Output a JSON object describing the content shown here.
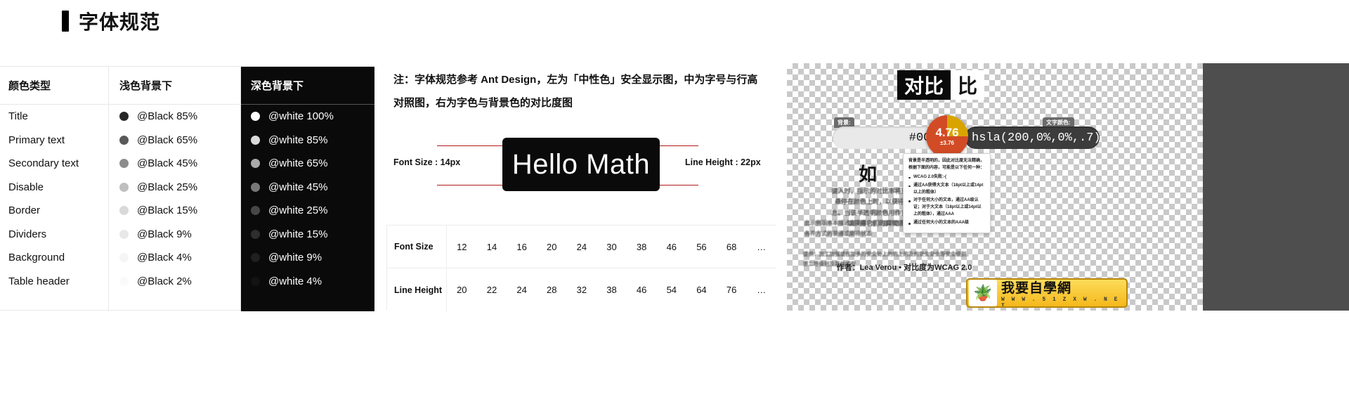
{
  "page": {
    "title": "字体规范"
  },
  "color_table": {
    "headers": [
      "颜色类型",
      "浅色背景下",
      "深色背景下"
    ],
    "rows": [
      {
        "type": "Title",
        "light": "@Black 85%",
        "light_swatch": "rgba(0,0,0,0.85)",
        "dark": "@white 100%",
        "dark_swatch": "rgba(255,255,255,1)"
      },
      {
        "type": "Primary text",
        "light": "@Black 65%",
        "light_swatch": "rgba(0,0,0,0.65)",
        "dark": "@white 85%",
        "dark_swatch": "rgba(255,255,255,0.85)"
      },
      {
        "type": "Secondary text",
        "light": "@Black 45%",
        "light_swatch": "rgba(0,0,0,0.45)",
        "dark": "@white 65%",
        "dark_swatch": "rgba(255,255,255,0.65)"
      },
      {
        "type": "Disable",
        "light": "@Black 25%",
        "light_swatch": "rgba(0,0,0,0.25)",
        "dark": "@white 45%",
        "dark_swatch": "rgba(255,255,255,0.45)"
      },
      {
        "type": "Border",
        "light": "@Black 15%",
        "light_swatch": "rgba(0,0,0,0.15)",
        "dark": "@white 25%",
        "dark_swatch": "rgba(255,255,255,0.25)"
      },
      {
        "type": "Dividers",
        "light": "@Black 9%",
        "light_swatch": "rgba(0,0,0,0.09)",
        "dark": "@white 15%",
        "dark_swatch": "rgba(255,255,255,0.15)"
      },
      {
        "type": "Background",
        "light": "@Black 4%",
        "light_swatch": "rgba(0,0,0,0.04)",
        "dark": "@white 9%",
        "dark_swatch": "rgba(255,255,255,0.09)"
      },
      {
        "type": "Table header",
        "light": "@Black 2%",
        "light_swatch": "rgba(0,0,0,0.02)",
        "dark": "@white 4%",
        "dark_swatch": "rgba(255,255,255,0.04)"
      }
    ]
  },
  "note": {
    "line1": "注：字体规范参考 Ant Design，左为「中性色」安全显示图，中为字号与行高",
    "line2": "对照图，右为字色与背景色的对比度图"
  },
  "typespec": {
    "font_size_label": "Font Size : 14px",
    "line_height_label": "Line Height : 22px",
    "sample_text": "Hello Math"
  },
  "size_table": {
    "row1_label": "Font Size",
    "row1_values": [
      "12",
      "14",
      "16",
      "20",
      "24",
      "30",
      "38",
      "46",
      "56",
      "68",
      "…"
    ],
    "row2_label": "Line Height",
    "row2_values": [
      "20",
      "22",
      "24",
      "28",
      "32",
      "38",
      "46",
      "54",
      "64",
      "76",
      "…"
    ]
  },
  "contrast": {
    "title_a": "对比",
    "title_b": "比",
    "bg_tag": "背景:",
    "fg_tag": "文字颜色:",
    "bg_value": "#00000",
    "fg_value": "hsla(200,0%,0%,.7)",
    "score_value": "4.76",
    "score_delta": "±3.76",
    "big_text": "如",
    "blur_text_1": "键入时，指示的对比率将更新。将鼠标悬停在颜色上时，以获得更多详细信息。当该半透明颜色用作背景时，您可以获得它们的真实混迭值。",
    "blur_text_2": "此示例版本本描述直观展示示显示颜色色的分的色性本性能示示各件方式的普通或期待状态",
    "blur_footer": "提供：加工加强或在加多的安全处上的的上的及的安全安全等安全级别，第二等级别及其他或安",
    "author": "作者：Lea Verou • 对比度为WCAG 2.0",
    "tooltip_intro": "背景是半透明的，因此对比度无法精确，根据下面的内容，可能是以下任何一种：",
    "tooltip_items": [
      "WCAG 2.0失败:-(",
      "通过AA获得大文本（18pt以上或14pt以上的粗体）",
      "对于任何大小的文本，通过AA级认证；对于大文本（18pt以上或14pt以上的粗体），通过AAA",
      "通过任何大小的文本的AAA级"
    ],
    "logo_text": "我要自學網",
    "logo_url": "W W W . 5 1 Z X W . N E T"
  }
}
